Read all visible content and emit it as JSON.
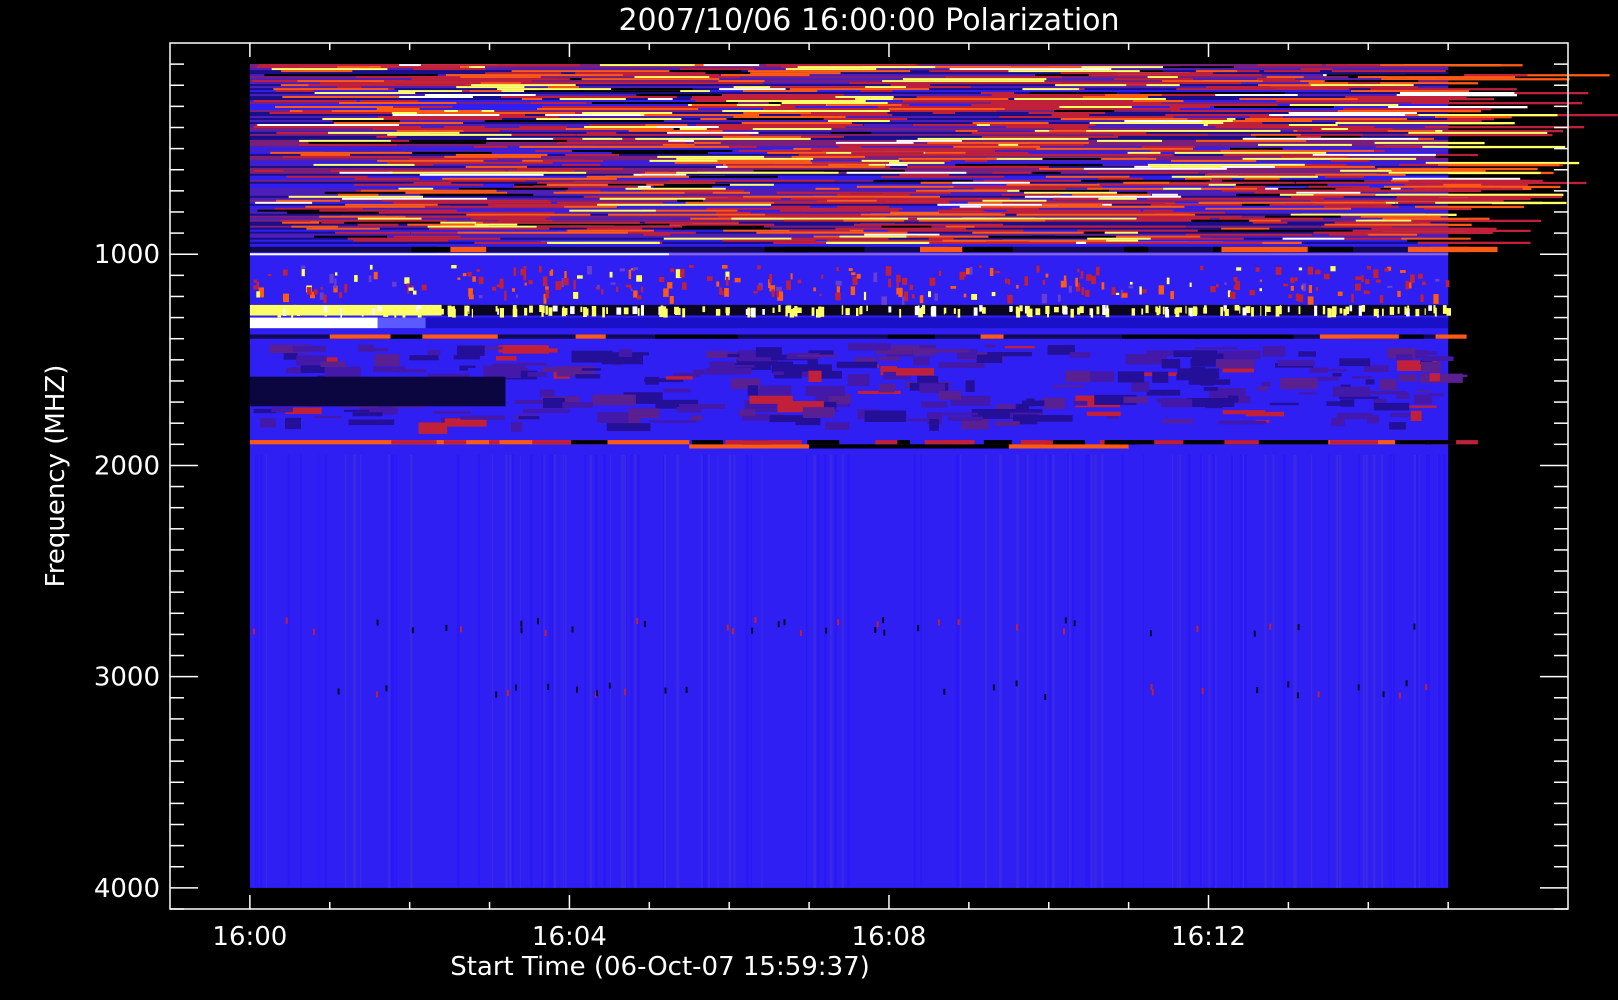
{
  "chart_data": {
    "type": "heatmap",
    "title": "2007/10/06 16:00:00 Polarization",
    "xlabel": "Start Time (06-Oct-07 15:59:37)",
    "ylabel": "Frequency (MHZ)",
    "x_ticks": [
      "16:00",
      "16:04",
      "16:08",
      "16:12"
    ],
    "y_ticks": [
      1000,
      2000,
      3000,
      4000
    ],
    "x_range_minutes": [
      -1.0,
      16.5
    ],
    "data_x_range_minutes": [
      0,
      15
    ],
    "y_range": [
      0,
      4100
    ],
    "data_y_range": [
      100,
      4000
    ],
    "y_reversed": true,
    "colors": {
      "background": "#000000",
      "axes": "#ffffff",
      "base": "#2f1ff2",
      "low": "#1a0f8a",
      "mid": "#c0203a",
      "orange": "#ff5a14",
      "high": "#ffff66",
      "max": "#ffffff"
    },
    "bands": [
      {
        "from": 100,
        "to": 950,
        "kind": "noisy-rfi"
      },
      {
        "from": 965,
        "to": 990,
        "kind": "dark-line"
      },
      {
        "from": 995,
        "to": 1005,
        "kind": "white-line"
      },
      {
        "from": 1050,
        "to": 1200,
        "kind": "speckled"
      },
      {
        "from": 1240,
        "to": 1290,
        "kind": "yellow-burst"
      },
      {
        "from": 1300,
        "to": 1350,
        "kind": "white-burst"
      },
      {
        "from": 1380,
        "to": 1400,
        "kind": "dark-line"
      },
      {
        "from": 1420,
        "to": 1800,
        "kind": "purple-mottled"
      },
      {
        "from": 1880,
        "to": 1920,
        "kind": "orange-line"
      },
      {
        "from": 1920,
        "to": 4000,
        "kind": "blue-base"
      }
    ]
  }
}
